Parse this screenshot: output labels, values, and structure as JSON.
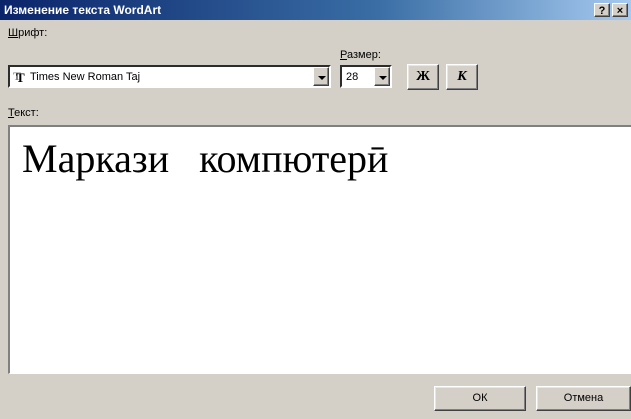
{
  "window": {
    "title": "Изменение текста WordArt",
    "help_label": "?",
    "close_label": "×"
  },
  "font": {
    "label_accel": "Ш",
    "label_rest": "рифт:",
    "value": "Times New Roman Taj"
  },
  "size": {
    "label_accel": "Р",
    "label_rest": "азмер:",
    "value": "28"
  },
  "format": {
    "bold_label": "Ж",
    "italic_label": "К"
  },
  "text": {
    "label_accel": "Т",
    "label_rest": "екст:",
    "content": "Маркази   компютерӣ"
  },
  "buttons": {
    "ok_label": "ОК",
    "cancel_label": "Отмена"
  }
}
